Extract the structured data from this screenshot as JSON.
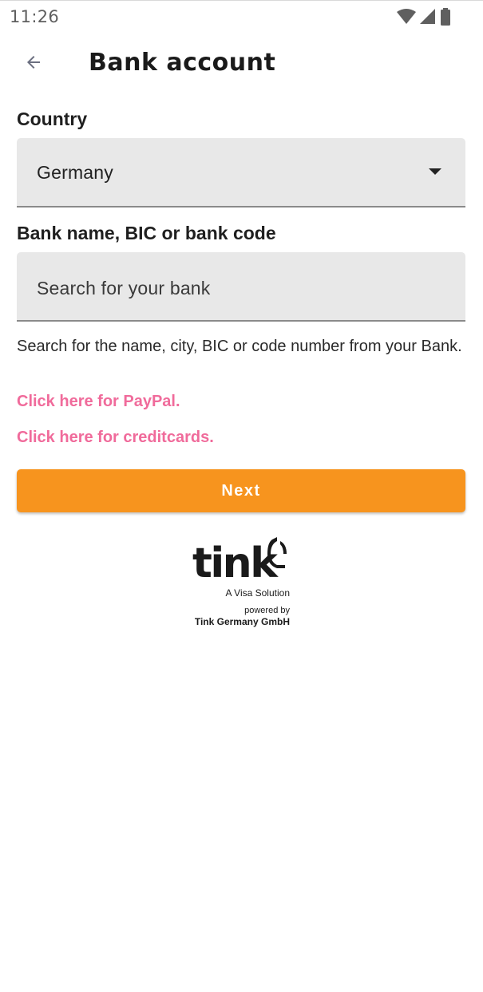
{
  "status_bar": {
    "time": "11:26",
    "icons": [
      "wifi-icon",
      "signal-icon",
      "battery-icon"
    ]
  },
  "header": {
    "back_icon": "arrow-left-icon",
    "title": "Bank account"
  },
  "country": {
    "label": "Country",
    "value": "Germany",
    "dropdown_icon": "caret-down-icon"
  },
  "bank": {
    "label": "Bank name, BIC or bank code",
    "value": "",
    "placeholder": "Search for your bank",
    "helper": "Search for the name, city, BIC or code number from your Bank."
  },
  "links": {
    "paypal": "Click here for PayPal.",
    "creditcards": "Click here for creditcards."
  },
  "actions": {
    "next_label": "Next"
  },
  "branding": {
    "logo_text": "tink",
    "tagline": "A Visa Solution",
    "powered_by": "powered by",
    "company": "Tink Germany GmbH"
  },
  "colors": {
    "accent": "#f7941e",
    "link": "#f06b9b",
    "field_bg": "#e8e8e8",
    "text": "#1f1f1f"
  }
}
